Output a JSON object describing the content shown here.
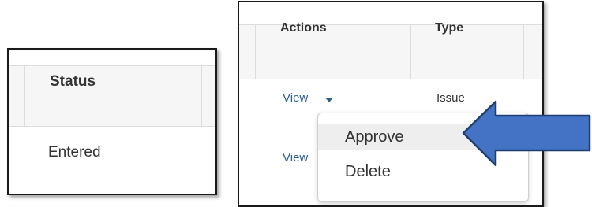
{
  "left_panel": {
    "header": {
      "status": "Status"
    },
    "row": {
      "status": "Entered"
    }
  },
  "right_panel": {
    "header": {
      "actions": "Actions",
      "type": "Type"
    },
    "rows": [
      {
        "action_link": "View",
        "type": "Issue"
      },
      {
        "action_link": "View",
        "type": ""
      }
    ],
    "dropdown": {
      "items": [
        {
          "label": "Approve",
          "highlighted": true
        },
        {
          "label": "Delete",
          "highlighted": false
        }
      ]
    }
  },
  "annotation": {
    "arrow_color": "#4472c4",
    "arrow_outline": "#1f3f70"
  }
}
